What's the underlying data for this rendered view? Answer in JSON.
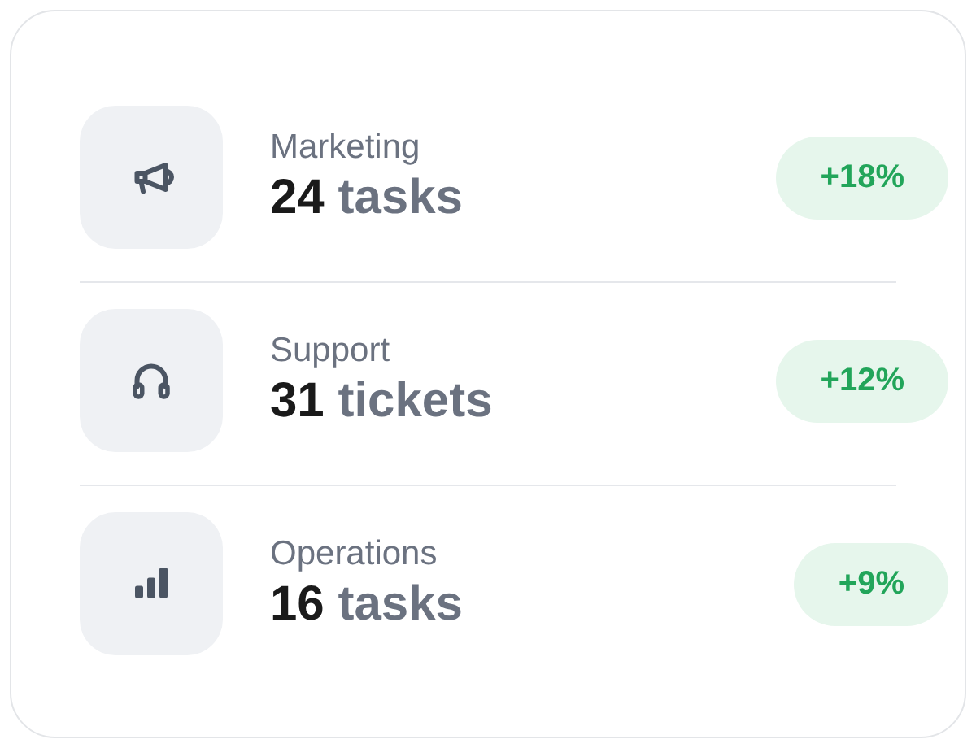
{
  "items": [
    {
      "kind": "megaphone",
      "label": "Marketing",
      "count": "24",
      "unit": "tasks",
      "change": "+18%"
    },
    {
      "kind": "headphones",
      "label": "Support",
      "count": "31",
      "unit": "tickets",
      "change": "+12%"
    },
    {
      "kind": "bars",
      "label": "Operations",
      "count": "16",
      "unit": "tasks",
      "change": "+9%"
    }
  ]
}
